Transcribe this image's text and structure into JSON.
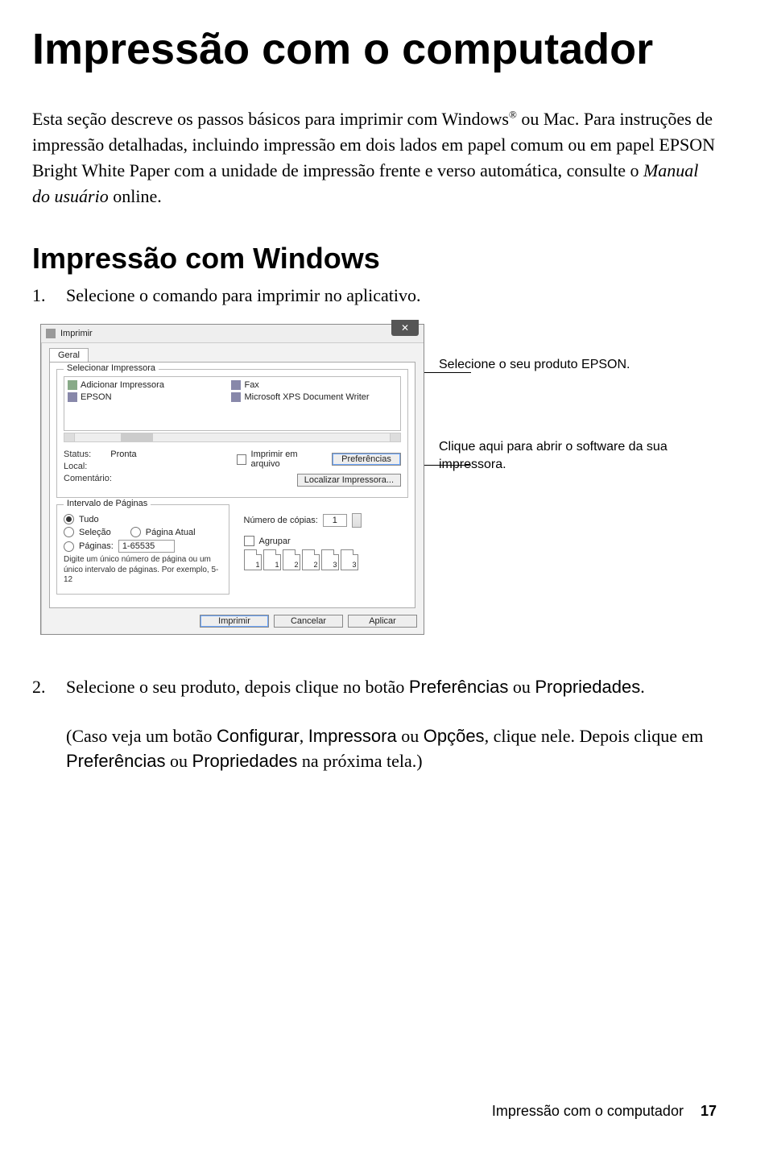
{
  "title": "Impressão com o computador",
  "intro": {
    "p1a": "Esta seção descreve os passos básicos para imprimir com Windows",
    "p1b": " ou Mac. Para instruções de impressão detalhadas, incluindo impressão em dois lados em papel comum ou em papel EPSON Bright White Paper com a unidade de impressão frente e verso automática, consulte o ",
    "p1c": "Manual do usuário",
    "p1d": " online."
  },
  "section2": "Impressão com Windows",
  "steps": {
    "1": {
      "num": "1.",
      "text": "Selecione o comando para imprimir no aplicativo."
    },
    "2": {
      "num": "2.",
      "a": "Selecione o seu produto, depois clique no botão ",
      "b": "Preferências",
      "c": " ou ",
      "d": "Propriedades",
      "e": ".",
      "f": "(Caso veja um botão ",
      "g": "Configurar",
      "h": ", ",
      "i": "Impressora",
      "j": " ou ",
      "k": "Opções",
      "l": ", clique nele. Depois clique em ",
      "m": "Preferências",
      "n": " ou ",
      "o": "Propriedades",
      "p": " na próxima tela.)"
    }
  },
  "callouts": {
    "c1": "Selecione o seu produto EPSON.",
    "c2": "Clique aqui para abrir o software da sua impressora."
  },
  "dialog": {
    "title": "Imprimir",
    "tab": "Geral",
    "grp_printer": "Selecionar Impressora",
    "printers": {
      "add": "Adicionar Impressora",
      "epson": "EPSON",
      "fax": "Fax",
      "xps": "Microsoft XPS Document Writer"
    },
    "status_lbl": "Status:",
    "status_val": "Pronta",
    "local_lbl": "Local:",
    "comment_lbl": "Comentário:",
    "print_to_file": "Imprimir em arquivo",
    "btn_prefs": "Preferências",
    "btn_find": "Localizar Impressora...",
    "grp_range": "Intervalo de Páginas",
    "range_all": "Tudo",
    "range_sel": "Seleção",
    "range_cur": "Página Atual",
    "range_pages_lbl": "Páginas:",
    "range_pages_val": "1-65535",
    "range_hint": "Digite um único número de página ou um único intervalo de páginas. Por exemplo, 5-12",
    "copies_lbl": "Número de cópias:",
    "copies_val": "1",
    "collate": "Agrupar",
    "btn_print": "Imprimir",
    "btn_cancel": "Cancelar",
    "btn_apply": "Aplicar",
    "collate_p1": "1",
    "collate_p2": "2",
    "collate_p3": "3"
  },
  "footer": {
    "text": "Impressão com o computador",
    "page": "17"
  }
}
